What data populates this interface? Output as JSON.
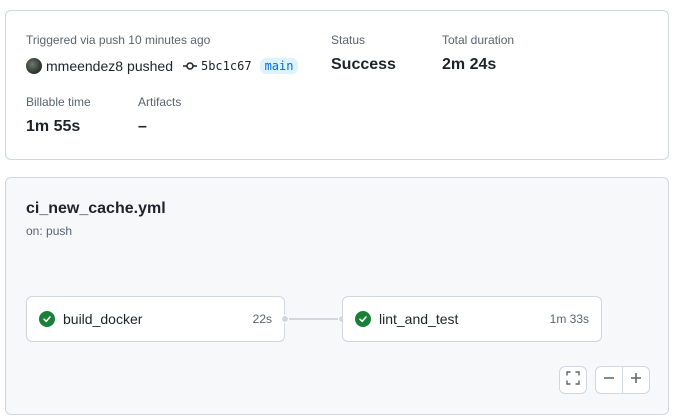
{
  "summary": {
    "trigger_label": "Triggered via push 10 minutes ago",
    "actor": "mmeendez8",
    "action": "pushed",
    "commit_sha": "5bc1c67",
    "branch": "main",
    "status_label": "Status",
    "status_value": "Success",
    "duration_label": "Total duration",
    "duration_value": "2m 24s",
    "billable_label": "Billable time",
    "billable_value": "1m 55s",
    "artifacts_label": "Artifacts",
    "artifacts_value": "–"
  },
  "workflow": {
    "file_name": "ci_new_cache.yml",
    "trigger": "on: push",
    "jobs": [
      {
        "name": "build_docker",
        "duration": "22s",
        "status": "success"
      },
      {
        "name": "lint_and_test",
        "duration": "1m 33s",
        "status": "success"
      }
    ]
  },
  "controls": {
    "fullscreen_icon": "fullscreen-icon",
    "zoom_out_icon": "minus-icon",
    "zoom_in_icon": "plus-icon"
  },
  "colors": {
    "success": "#1a7f37",
    "branch_text": "#0969da",
    "branch_bg": "#ddf4ff",
    "panel_bg": "#f6f8fa",
    "border": "#d0d7de"
  }
}
